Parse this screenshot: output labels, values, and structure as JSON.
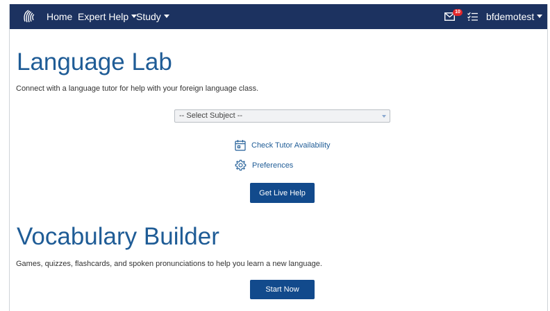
{
  "nav": {
    "home": "Home",
    "expert_help": "Expert Help",
    "study": "Study",
    "notification_count": "10",
    "username": "bfdemotest"
  },
  "language_lab": {
    "title": "Language Lab",
    "description": "Connect with a language tutor for help with your foreign language class.",
    "select_placeholder": "-- Select Subject --",
    "check_availability": "Check Tutor Availability",
    "preferences": "Preferences",
    "get_help_button": "Get Live Help"
  },
  "vocabulary_builder": {
    "title": "Vocabulary Builder",
    "description": "Games, quizzes, flashcards, and spoken pronunciations to help you learn a new language.",
    "start_button": "Start Now"
  },
  "colors": {
    "navbar": "#1c3260",
    "heading": "#1f5c96",
    "button": "#124a8c",
    "badge": "#e3262a"
  }
}
